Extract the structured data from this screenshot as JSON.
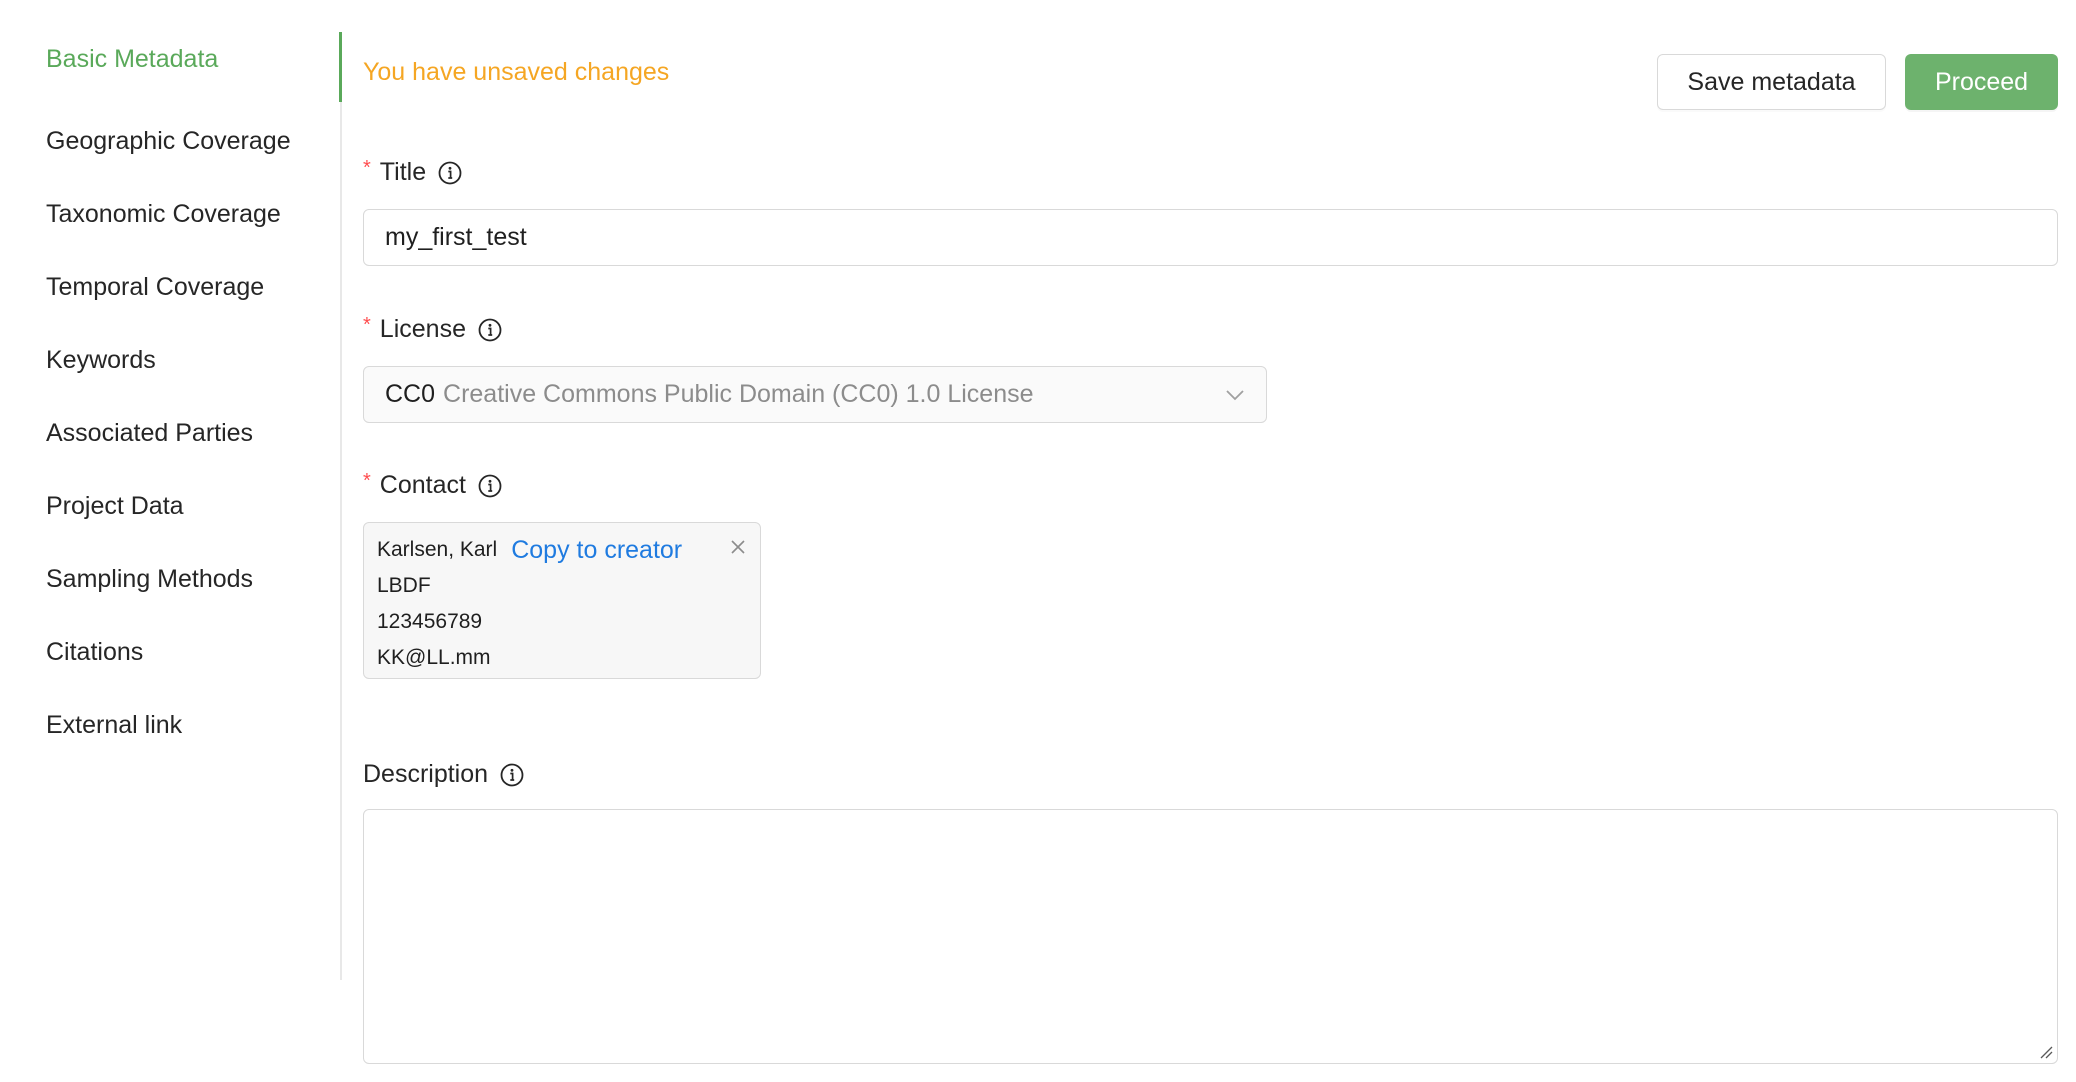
{
  "sidebar": {
    "items": [
      {
        "label": "Basic Metadata",
        "active": true
      },
      {
        "label": "Geographic Coverage"
      },
      {
        "label": "Taxonomic Coverage"
      },
      {
        "label": "Temporal Coverage"
      },
      {
        "label": "Keywords"
      },
      {
        "label": "Associated Parties"
      },
      {
        "label": "Project Data"
      },
      {
        "label": "Sampling Methods"
      },
      {
        "label": "Citations"
      },
      {
        "label": "External link"
      }
    ]
  },
  "header": {
    "status": "You have unsaved changes",
    "save_label": "Save metadata",
    "proceed_label": "Proceed"
  },
  "form": {
    "title": {
      "required_mark": "*",
      "label": "Title",
      "value": "my_first_test"
    },
    "license": {
      "required_mark": "*",
      "label": "License",
      "code": "CC0",
      "name": "Creative Commons Public Domain (CC0) 1.0 License"
    },
    "contact": {
      "required_mark": "*",
      "label": "Contact",
      "name": "Karlsen, Karl",
      "copy_label": "Copy to creator",
      "organization": "LBDF",
      "phone": "123456789",
      "email": "KK@LL.mm"
    },
    "description": {
      "label": "Description",
      "value": ""
    }
  },
  "colors": {
    "accent": "#5aa95a",
    "primary_button": "#6db26d",
    "warning": "#f5a623",
    "link": "#1f7be0",
    "required": "#ff4d4f"
  }
}
